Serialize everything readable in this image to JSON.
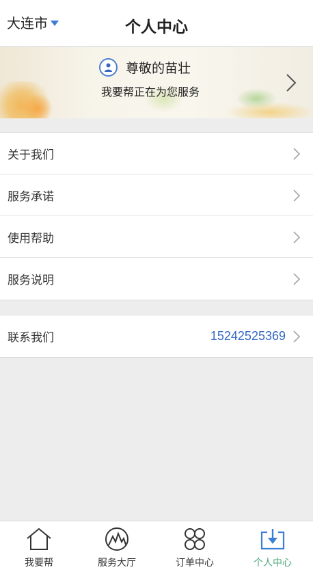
{
  "header": {
    "city": "大连市",
    "title": "个人中心"
  },
  "banner": {
    "greeting": "尊敬的苗壮",
    "subtext": "我要帮正在为您服务"
  },
  "menu_group1": [
    {
      "label": "关于我们"
    },
    {
      "label": "服务承诺"
    },
    {
      "label": "使用帮助"
    },
    {
      "label": "服务说明"
    }
  ],
  "menu_group2": [
    {
      "label": "联系我们",
      "value": "15242525369"
    }
  ],
  "tabs": [
    {
      "label": "我要帮",
      "icon": "home-icon"
    },
    {
      "label": "服务大厅",
      "icon": "mountain-icon"
    },
    {
      "label": "订单中心",
      "icon": "grid-icon"
    },
    {
      "label": "个人中心",
      "icon": "download-box-icon",
      "active": true
    }
  ],
  "colors": {
    "accent_blue": "#3a7fd5",
    "phone_blue": "#3568c3",
    "active_green": "#4aa77a",
    "background": "#ededed"
  }
}
